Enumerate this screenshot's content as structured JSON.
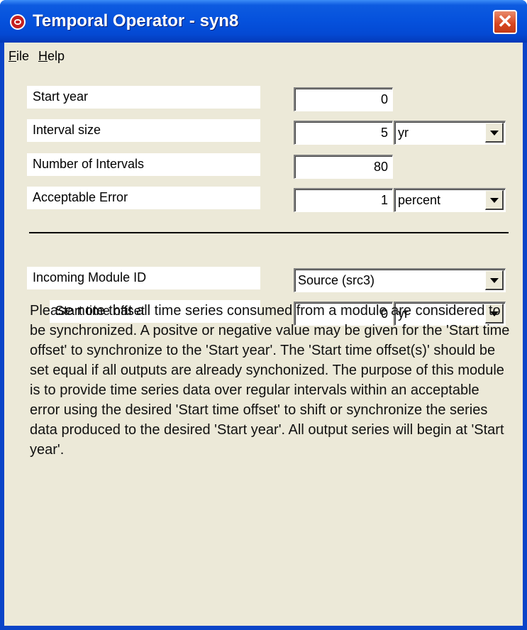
{
  "window": {
    "title": "Temporal Operator - syn8",
    "close_glyph": "✕",
    "app_icon": "app-logo-icon"
  },
  "menu": {
    "file": {
      "mnemonic": "F",
      "rest": "ile"
    },
    "help": {
      "mnemonic": "H",
      "rest": "elp"
    }
  },
  "form": {
    "start_year": {
      "label": "Start year",
      "value": "0"
    },
    "interval_size": {
      "label": "Interval size",
      "value": "5",
      "unit": "yr"
    },
    "num_intervals": {
      "label": "Number of Intervals",
      "value": "80"
    },
    "acceptable_error": {
      "label": "Acceptable Error",
      "value": "1",
      "unit": "percent"
    },
    "incoming_module": {
      "label": "Incoming Module ID",
      "value": "Source (src3)"
    },
    "start_time_offset": {
      "label": "Start time offset",
      "value": "0",
      "unit": "yr"
    }
  },
  "note": "Please note that all time series consumed from a module are considered to be synchronized.  A positve or negative value may be given for the 'Start time offset' to synchronize to the 'Start year'.  The 'Start time offset(s)' should be set equal if all outputs are already synchonized.  The purpose of this module is to provide time series data over regular intervals within an acceptable error using the desired 'Start time offset' to shift or synchronize the series data produced to the desired 'Start year'.  All output series will begin at 'Start year'.",
  "colors": {
    "titlebar": "#0551dc",
    "client_bg": "#ece9d8",
    "close_button": "#d6451f"
  }
}
